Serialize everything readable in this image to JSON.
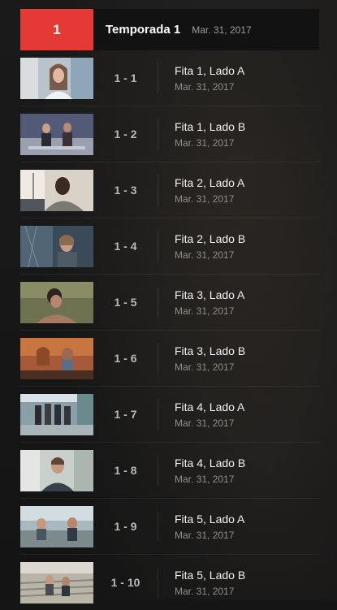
{
  "season": {
    "number": "1",
    "title": "Temporada 1",
    "date": "Mar. 31, 2017",
    "accent_color": "#e53935"
  },
  "episodes": [
    {
      "number": "1 - 1",
      "title": "Fita 1, Lado A",
      "date": "Mar. 31, 2017"
    },
    {
      "number": "1 - 2",
      "title": "Fita 1, Lado B",
      "date": "Mar. 31, 2017"
    },
    {
      "number": "1 - 3",
      "title": "Fita 2, Lado A",
      "date": "Mar. 31, 2017"
    },
    {
      "number": "1 - 4",
      "title": "Fita 2, Lado B",
      "date": "Mar. 31, 2017"
    },
    {
      "number": "1 - 5",
      "title": "Fita 3, Lado A",
      "date": "Mar. 31, 2017"
    },
    {
      "number": "1 - 6",
      "title": "Fita 3, Lado B",
      "date": "Mar. 31, 2017"
    },
    {
      "number": "1 - 7",
      "title": "Fita 4, Lado A",
      "date": "Mar. 31, 2017"
    },
    {
      "number": "1 - 8",
      "title": "Fita 4, Lado B",
      "date": "Mar. 31, 2017"
    },
    {
      "number": "1 - 9",
      "title": "Fita 5, Lado A",
      "date": "Mar. 31, 2017"
    },
    {
      "number": "1 - 10",
      "title": "Fita 5, Lado B",
      "date": "Mar. 31, 2017"
    }
  ]
}
